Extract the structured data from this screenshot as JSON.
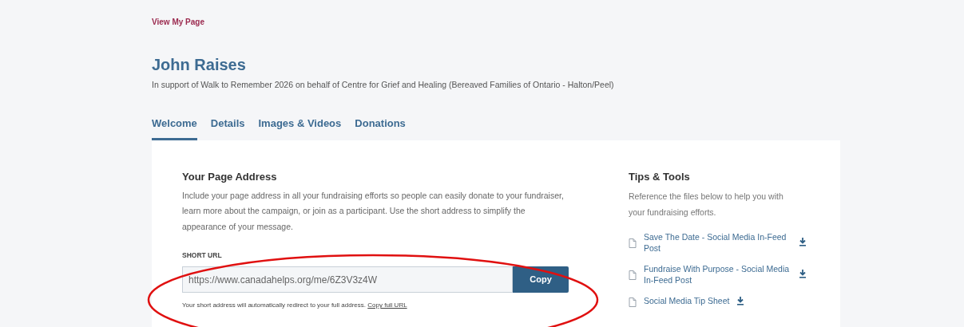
{
  "header_link": "View My Page",
  "title": "John Raises",
  "subtitle": "In support of Walk to Remember 2026 on behalf of Centre for Grief and Healing (Bereaved Families of Ontario - Halton/Peel)",
  "tabs": [
    {
      "label": "Welcome",
      "selected": true
    },
    {
      "label": "Details",
      "selected": false
    },
    {
      "label": "Images & Videos",
      "selected": false
    },
    {
      "label": "Donations",
      "selected": false
    }
  ],
  "page_address": {
    "heading": "Your Page Address",
    "description": "Include your page address in all your fundraising efforts so people can easily donate to your fundraiser, learn more about the campaign, or join as a participant. Use the short address to simplify the appearance of your message.",
    "field_label": "SHORT URL",
    "value": "https://www.canadahelps.org/me/6Z3V3z4W",
    "button": "Copy",
    "note": "Your short address will automatically redirect to your full address.",
    "note_link": "Copy full URL"
  },
  "tips": {
    "heading": "Tips & Tools",
    "description": "Reference the files below to help you with your fundraising efforts.",
    "files": [
      {
        "name": "Save The Date - Social Media In-Feed Post"
      },
      {
        "name": "Fundraise With Purpose - Social Media In-Feed Post"
      },
      {
        "name": "Social Media Tip Sheet"
      }
    ]
  }
}
